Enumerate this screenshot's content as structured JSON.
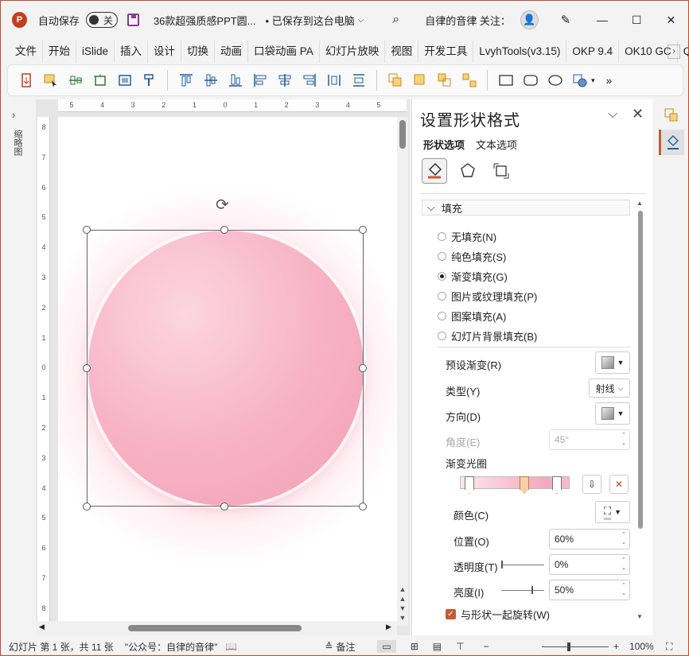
{
  "titlebar": {
    "logo": "P",
    "autosave_label": "自动保存",
    "autosave_state": "关",
    "file_name": "36款超强质感PPT圆...",
    "save_status": "• 已保存到这台电脑",
    "account_text": "自律的音律 关注：",
    "minimize": "—",
    "restore": "☐",
    "close": "✕"
  },
  "menubar": [
    "文件",
    "开始",
    "iSlide",
    "插入",
    "设计",
    "切换",
    "动画",
    "口袋动画 PA",
    "幻灯片放映",
    "视图",
    "开发工具",
    "LvyhTools(v3.15)",
    "OKP 9.4",
    "OK10 GC",
    "Qir"
  ],
  "ribbon": {
    "more": "»",
    "icons": [
      "transform-icon",
      "select-icon",
      "align-h-icon",
      "crop-icon",
      "frame-icon",
      "format-painter-icon",
      "align-top-icon",
      "align-middle-icon",
      "align-bottom-icon",
      "align-left-icon",
      "align-center-icon",
      "align-right-icon",
      "distribute-h-icon",
      "distribute-v-icon",
      "layer-front-icon",
      "layer-icon",
      "group-icon",
      "ungroup-icon",
      "rect-icon",
      "rounded-rect-icon",
      "ellipse-icon",
      "shape-fill-icon"
    ]
  },
  "thumbnail_panel": {
    "label": "缩略图",
    "expand": "›"
  },
  "ruler": {
    "h_labels": [
      "5",
      "4",
      "3",
      "2",
      "1",
      "0",
      "1",
      "2",
      "3",
      "4",
      "5"
    ],
    "v_labels": [
      "8",
      "7",
      "6",
      "5",
      "4",
      "3",
      "2",
      "1",
      "0",
      "1",
      "2",
      "3",
      "4",
      "5",
      "6",
      "7",
      "8"
    ]
  },
  "format_pane": {
    "title": "设置形状格式",
    "tab_shape": "形状选项",
    "tab_text": "文本选项",
    "section": "填充",
    "fill_options": [
      {
        "label": "无填充(N)",
        "selected": false
      },
      {
        "label": "纯色填充(S)",
        "selected": false
      },
      {
        "label": "渐变填充(G)",
        "selected": true
      },
      {
        "label": "图片或纹理填充(P)",
        "selected": false
      },
      {
        "label": "图案填充(A)",
        "selected": false
      },
      {
        "label": "幻灯片背景填充(B)",
        "selected": false
      }
    ],
    "preset_label": "预设渐变(R)",
    "type_label": "类型(Y)",
    "type_value": "射线",
    "direction_label": "方向(D)",
    "angle_label": "角度(E)",
    "angle_value": "45°",
    "stops_label": "渐变光圈",
    "color_label": "颜色(C)",
    "position_label": "位置(O)",
    "position_value": "60%",
    "transparency_label": "透明度(T)",
    "transparency_value": "0%",
    "brightness_label": "亮度(I)",
    "brightness_value": "50%",
    "rotate_label": "与形状一起旋转(W)",
    "rotate_checked": true
  },
  "statusbar": {
    "slide_info": "幻灯片 第 1 张，共 11 张",
    "author": "\"公众号：自律的音律\"",
    "notes": "备注",
    "zoom_minus": "−",
    "zoom_plus": "+",
    "zoom": "100%"
  },
  "colors": {
    "accent": "#c43e1c",
    "circle_light": "#fcd6df",
    "circle_dark": "#f29fb5"
  }
}
